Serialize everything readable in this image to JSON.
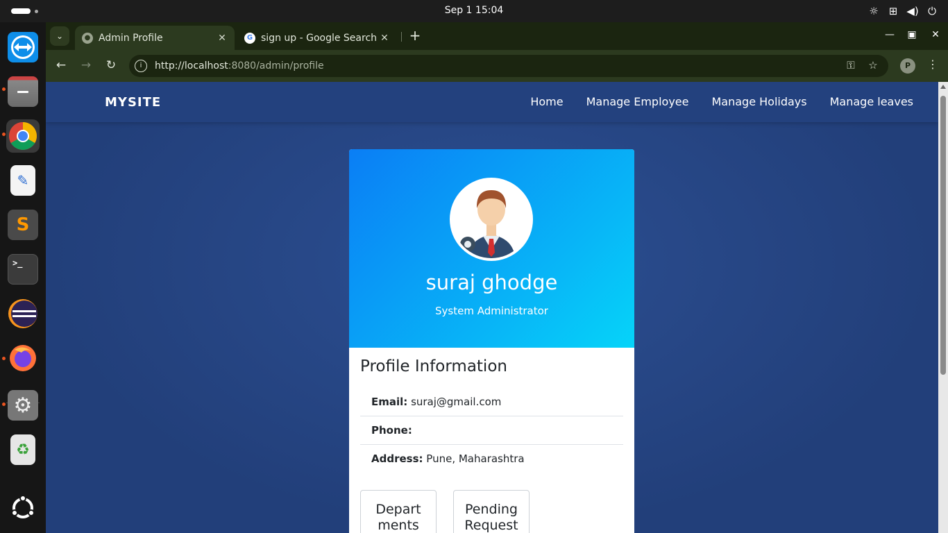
{
  "system": {
    "clock": "Sep 1  15:04",
    "tray_icons": [
      "brightness-icon",
      "network-icon",
      "volume-icon",
      "power-icon"
    ]
  },
  "dock": {
    "apps": [
      {
        "name": "teamviewer-icon",
        "running": false
      },
      {
        "name": "files-icon",
        "running": true
      },
      {
        "name": "chrome-icon",
        "running": true
      },
      {
        "name": "text-editor-icon",
        "running": false
      },
      {
        "name": "sublime-text-icon",
        "running": false
      },
      {
        "name": "terminal-icon",
        "running": false
      },
      {
        "name": "eclipse-icon",
        "running": false
      },
      {
        "name": "firefox-icon",
        "running": true
      },
      {
        "name": "settings-icon",
        "running": true
      },
      {
        "name": "trash-icon",
        "running": false
      },
      {
        "name": "show-apps-icon",
        "running": false
      }
    ],
    "terminal_glyph": ">_"
  },
  "browser": {
    "tabs": [
      {
        "title": "Admin Profile",
        "active": true
      },
      {
        "title": "sign up - Google Search",
        "active": false
      }
    ],
    "url_host": "http://localhost",
    "url_path": ":8080/admin/profile",
    "profile_initial": "P"
  },
  "site": {
    "brand": "MYSITE",
    "nav": [
      "Home",
      "Manage Employee",
      "Manage Holidays",
      "Manage leaves"
    ]
  },
  "profile": {
    "name": "suraj ghodge",
    "role": "System Administrator",
    "section_title": "Profile Information",
    "email_label": "Email:",
    "email": "suraj@gmail.com",
    "phone_label": "Phone:",
    "phone": "",
    "address_label": "Address:",
    "address": "Pune, Maharashtra",
    "tiles": [
      {
        "line1": "Depart",
        "line2": "ments"
      },
      {
        "line1": "Pending",
        "line2": "Request"
      }
    ]
  },
  "colors": {
    "viewport_bg": "#264682",
    "header_gradient_start": "#0a7ef5",
    "header_gradient_end": "#05d4f9",
    "ubuntu_orange": "#e95420"
  }
}
